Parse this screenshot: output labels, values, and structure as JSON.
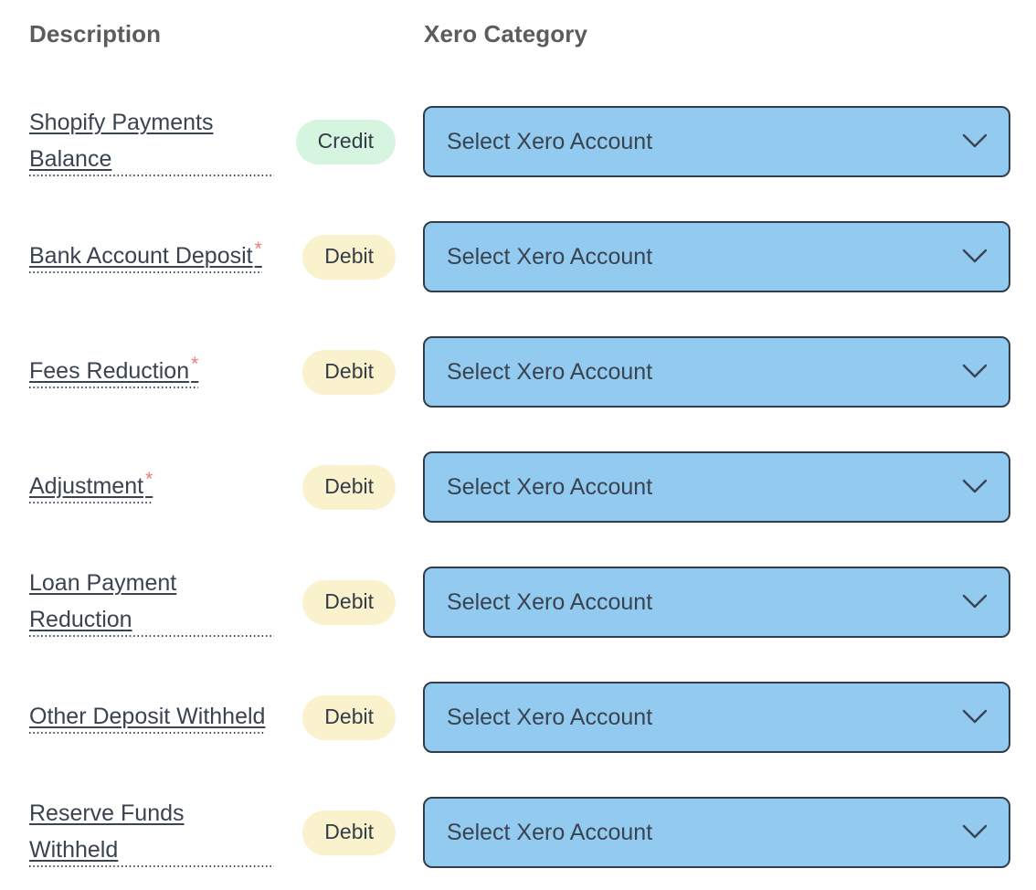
{
  "headers": {
    "description": "Description",
    "category": "Xero Category"
  },
  "select": {
    "placeholder": "Select Xero Account",
    "chevron_icon": "chevron-down-icon"
  },
  "required_marker": "*",
  "colors": {
    "select_fill": "#93caf0",
    "select_border": "#323d4b",
    "credit_badge_bg": "#d6f5e1",
    "debit_badge_bg": "#faf1cd",
    "badge_text": "#333c47",
    "header_text": "#5c5c5c",
    "description_text": "#3a4350",
    "required_star": "#ef7b74",
    "page_background": "#ffffff"
  },
  "rows": [
    {
      "description": "Shopify Payments Balance",
      "required": false,
      "type": "Credit",
      "type_kind": "credit",
      "select_value": "Select Xero Account"
    },
    {
      "description": "Bank Account Deposit",
      "required": true,
      "type": "Debit",
      "type_kind": "debit",
      "select_value": "Select Xero Account"
    },
    {
      "description": "Fees Reduction",
      "required": true,
      "type": "Debit",
      "type_kind": "debit",
      "select_value": "Select Xero Account"
    },
    {
      "description": "Adjustment",
      "required": true,
      "type": "Debit",
      "type_kind": "debit",
      "select_value": "Select Xero Account"
    },
    {
      "description": "Loan Payment Reduction",
      "required": false,
      "type": "Debit",
      "type_kind": "debit",
      "select_value": "Select Xero Account"
    },
    {
      "description": "Other Deposit Withheld",
      "required": false,
      "type": "Debit",
      "type_kind": "debit",
      "select_value": "Select Xero Account"
    },
    {
      "description": "Reserve Funds Withheld",
      "required": false,
      "type": "Debit",
      "type_kind": "debit",
      "select_value": "Select Xero Account"
    }
  ]
}
